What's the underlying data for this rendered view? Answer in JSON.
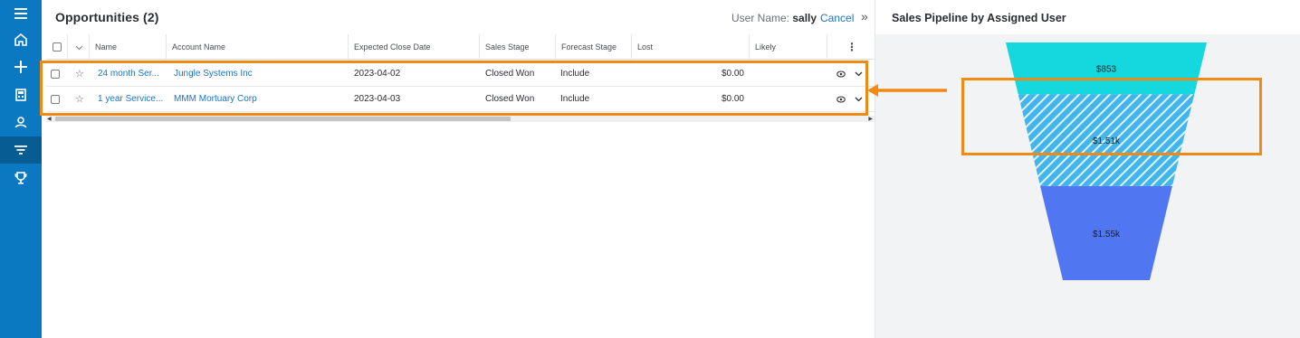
{
  "nav": {
    "items": [
      {
        "icon": "menu-icon"
      },
      {
        "icon": "home-icon"
      },
      {
        "icon": "plus-icon"
      },
      {
        "icon": "calculator-icon"
      },
      {
        "icon": "contacts-icon"
      },
      {
        "icon": "filter-icon"
      },
      {
        "icon": "trophy-icon"
      }
    ],
    "accent": "#0b79c2",
    "active_bg": "#085c94"
  },
  "header": {
    "title": "Opportunities (2)",
    "user_label": "User Name:",
    "user_value": "sally",
    "cancel_label": "Cancel",
    "collapse_icon": "»"
  },
  "table": {
    "columns": [
      "Name",
      "Account Name",
      "Expected Close Date",
      "Sales Stage",
      "Forecast Stage",
      "Lost",
      "Likely"
    ],
    "rows": [
      {
        "name": "24 month Ser...",
        "account": "Jungle Systems Inc",
        "close_date": "2023-04-02",
        "stage": "Closed Won",
        "forecast": "Include",
        "lost": "$0.00",
        "likely": ""
      },
      {
        "name": "1 year Service...",
        "account": "MMM Mortuary Corp",
        "close_date": "2023-04-03",
        "stage": "Closed Won",
        "forecast": "Include",
        "lost": "$0.00",
        "likely": ""
      }
    ]
  },
  "side": {
    "title": "Sales Pipeline by Assigned User"
  },
  "chart_data": {
    "type": "funnel",
    "title": "Sales Pipeline by Assigned User",
    "categories": [
      "",
      "",
      ""
    ],
    "values": [
      853,
      1510,
      1550
    ],
    "labels": [
      "$853",
      "$1.51k",
      "$1.55k"
    ],
    "colors": [
      "#14d8de",
      "#41b5ec",
      "#5176f2"
    ],
    "highlighted_index": 1
  },
  "annotation": {
    "color": "#f08a14"
  }
}
